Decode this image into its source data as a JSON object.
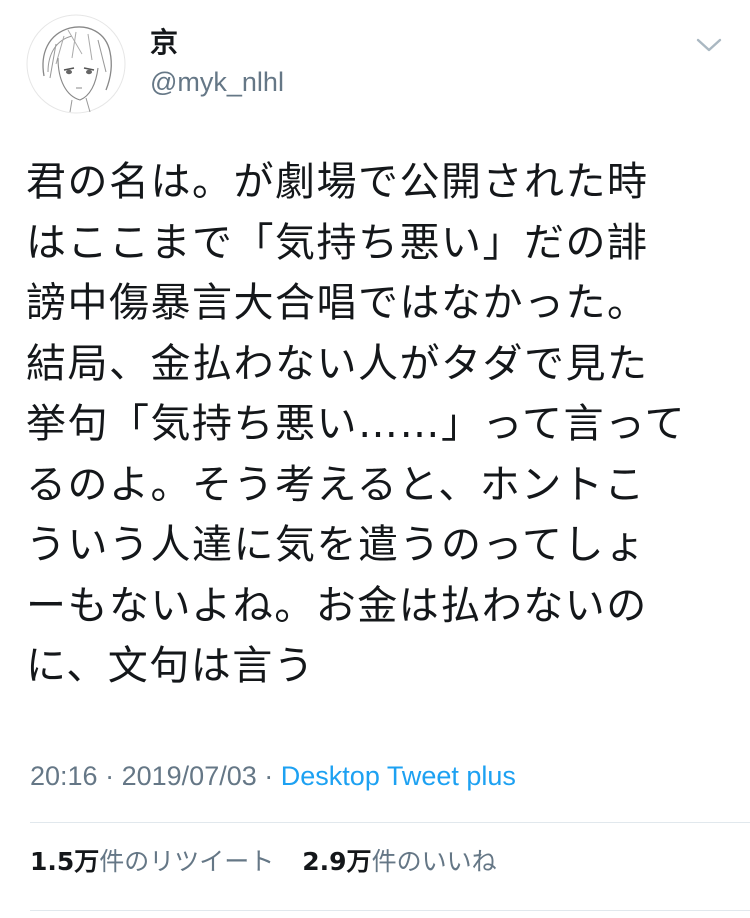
{
  "tweet": {
    "author": {
      "display_name": "京",
      "handle": "@myk_nlhl",
      "avatar": "avatar-sketch"
    },
    "menu_icon": "chevron-down-icon",
    "body_lines": [
      "君の名は。が劇場で公開された時",
      "はここまで「気持ち悪い」だの誹",
      "謗中傷暴言大合唱ではなかった。",
      "結局、金払わない人がタダで見た",
      "挙句「気持ち悪い……」って言って",
      "るのよ。そう考えると、ホントこ",
      "ういう人達に気を遣うのってしょ",
      "ーもないよね。お金は払わないの",
      "に、文句は言う"
    ],
    "meta": {
      "time": "20:16",
      "separator": "·",
      "date": "2019/07/03",
      "source": "Desktop Tweet plus"
    },
    "stats": {
      "retweets_count": "1.5万",
      "retweets_label": "件のリツイート",
      "likes_count": "2.9万",
      "likes_label": "件のいいね"
    },
    "colors": {
      "text": "#14171a",
      "secondary": "#657786",
      "link": "#1da1f2",
      "divider": "#e1e8ed"
    }
  }
}
